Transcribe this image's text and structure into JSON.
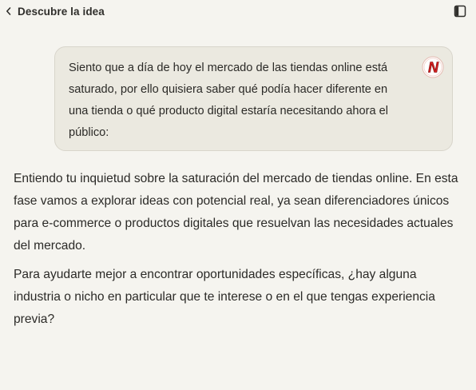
{
  "header": {
    "title": "Descubre la idea",
    "back_icon": "chevron-left-icon",
    "panel_icon": "sidebar-panel-icon"
  },
  "user_message": {
    "text": "Siento que a día de hoy el mercado de las tiendas online está saturado, por ello quisiera saber qué podía hacer diferente en una tienda o qué producto digital estaría necesitando ahora el público:",
    "avatar_letter": "N",
    "avatar_color": "#d42020"
  },
  "assistant_message": {
    "paragraphs": [
      "Entiendo tu inquietud sobre la saturación del mercado de tiendas online. En esta fase vamos a explorar ideas con potencial real, ya sean diferenciadores únicos para e-commerce o productos digitales que resuelvan las necesidades actuales del mercado.",
      "Para ayudarte mejor a encontrar oportunidades específicas, ¿hay alguna industria o nicho en particular que te interese o en el que tengas experiencia previa?"
    ]
  },
  "colors": {
    "background": "#f5f4ef",
    "bubble": "#ebe9e0",
    "text": "#2b2a27"
  }
}
